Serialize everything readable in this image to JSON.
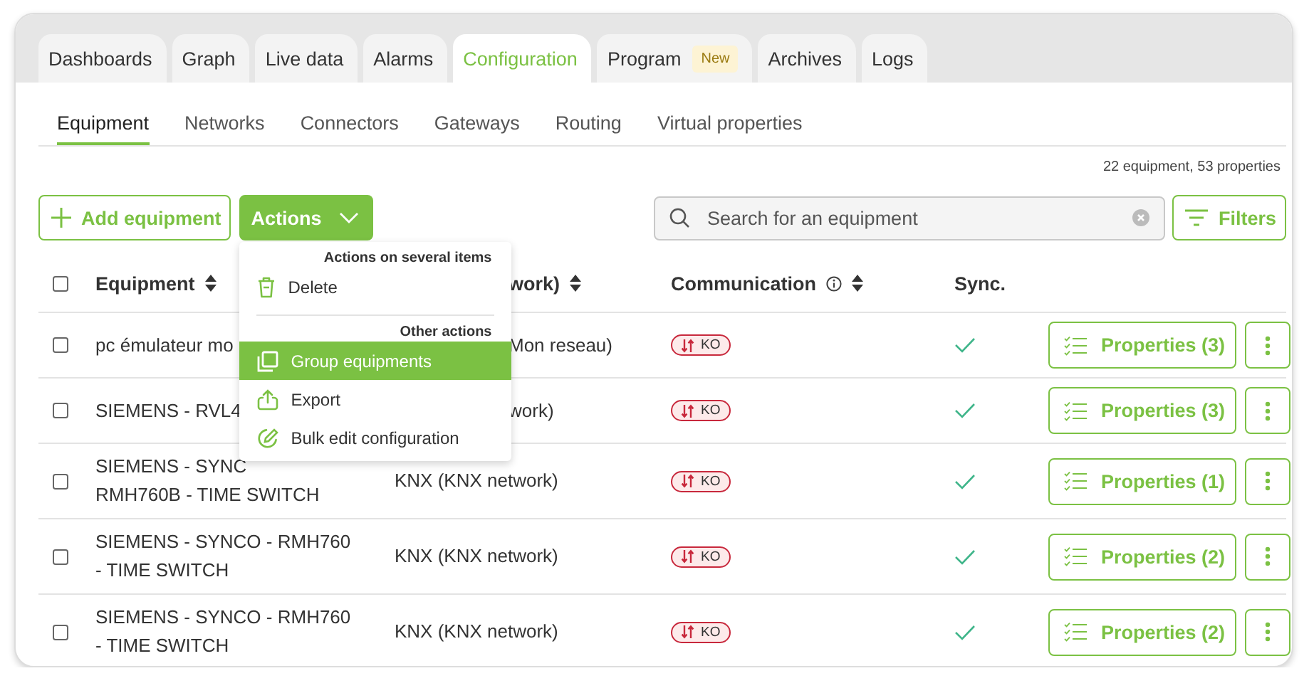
{
  "tabs": [
    {
      "label": "Dashboards",
      "selected": false
    },
    {
      "label": "Graph",
      "selected": false
    },
    {
      "label": "Live data",
      "selected": false
    },
    {
      "label": "Alarms",
      "selected": false
    },
    {
      "label": "Configuration",
      "selected": true
    },
    {
      "label": "Program",
      "badge": "New",
      "selected": false
    },
    {
      "label": "Archives",
      "selected": false
    },
    {
      "label": "Logs",
      "selected": false
    }
  ],
  "subtabs": [
    {
      "label": "Equipment",
      "selected": true
    },
    {
      "label": "Networks",
      "selected": false
    },
    {
      "label": "Connectors",
      "selected": false
    },
    {
      "label": "Gateways",
      "selected": false
    },
    {
      "label": "Routing",
      "selected": false
    },
    {
      "label": "Virtual properties",
      "selected": false
    }
  ],
  "summary": "22 equipment, 53 properties",
  "toolbar": {
    "add_button": "Add equipment",
    "actions_button": "Actions",
    "search": {
      "placeholder": "Search for an equipment"
    },
    "filters_button": "Filters"
  },
  "actions_menu": {
    "sections": [
      {
        "title": "Actions on several items",
        "items": [
          {
            "label": "Delete",
            "selected": false
          }
        ]
      },
      {
        "title": "Other actions",
        "items": [
          {
            "label": "Group equipments",
            "selected": true
          },
          {
            "label": "Export",
            "selected": false
          },
          {
            "label": "Bulk edit configuration",
            "selected": false
          }
        ]
      }
    ]
  },
  "table": {
    "select_all": {
      "checked": false
    },
    "columns": [
      {
        "label": "Equipment",
        "sortable": true
      },
      {
        "label": "work)",
        "sortable": true,
        "start_hidden": true
      },
      {
        "label": "Communication",
        "info": true,
        "sortable": true
      },
      {
        "label": "Sync.",
        "sortable": false
      }
    ],
    "rows": [
      {
        "checked": false,
        "name": [
          "pc émulateur mo"
        ],
        "network": "Mon reseau)",
        "network_start_hidden": true,
        "communication": "KO",
        "synced": true,
        "properties_button": "Properties (3)"
      },
      {
        "checked": false,
        "name": [
          "SIEMENS - RVL4"
        ],
        "network": "work)",
        "network_start_hidden": true,
        "communication": "KO",
        "synced": true,
        "properties_button": "Properties (3)"
      },
      {
        "checked": false,
        "name": [
          "SIEMENS - SYNC",
          "RMH760B - TIME SWITCH"
        ],
        "network": "KNX (KNX network)",
        "network_start_hidden": false,
        "communication": "KO",
        "synced": true,
        "properties_button": "Properties (1)"
      },
      {
        "checked": false,
        "name": [
          "SIEMENS - SYNCO - RMH760",
          "- TIME SWITCH"
        ],
        "network": "KNX (KNX network)",
        "network_start_hidden": false,
        "communication": "KO",
        "synced": true,
        "properties_button": "Properties (2)"
      },
      {
        "checked": false,
        "name": [
          "SIEMENS - SYNCO - RMH760",
          "- TIME SWITCH"
        ],
        "network": "KNX (KNX network)",
        "network_start_hidden": false,
        "communication": "KO",
        "synced": true,
        "properties_button": "Properties (2)"
      }
    ]
  }
}
